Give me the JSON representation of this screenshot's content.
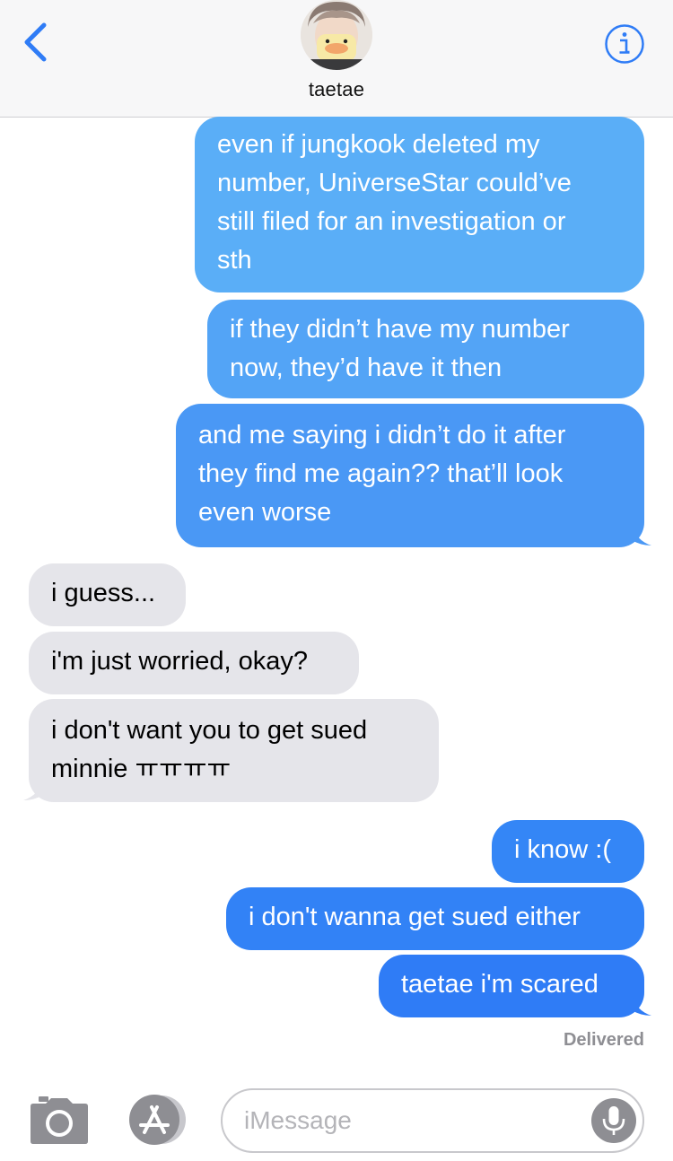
{
  "header": {
    "contact_name": "taetae",
    "back_icon": "chevron-left-icon",
    "info_icon": "info-icon",
    "accent_color": "#2f7cf6"
  },
  "messages": [
    {
      "direction": "outgoing",
      "text": "even if jungkook deleted my\nnumber, UniverseStar could’ve\nstill filed for an investigation or\nsth"
    },
    {
      "direction": "outgoing",
      "text": "if they didn’t have my number\nnow, they’d have it then"
    },
    {
      "direction": "outgoing",
      "text": "and me saying i didn’t do it after\nthey find me again?? that’ll look\neven worse"
    },
    {
      "direction": "incoming",
      "text": "i guess..."
    },
    {
      "direction": "incoming",
      "text": "i'm just worried, okay?"
    },
    {
      "direction": "incoming",
      "text": "i don't want you to get sued\nminnie ㅠㅠㅠㅠ"
    },
    {
      "direction": "outgoing",
      "text": "i know :("
    },
    {
      "direction": "outgoing",
      "text": "i don't wanna get sued either"
    },
    {
      "direction": "outgoing",
      "text": "taetae i'm scared"
    }
  ],
  "status": {
    "delivered": "Delivered"
  },
  "composer": {
    "placeholder": "iMessage",
    "camera_icon": "camera-icon",
    "apps_icon": "app-store-icon",
    "mic_icon": "microphone-icon"
  },
  "colors": {
    "outgoing_top": "#5ab0f7",
    "outgoing_bottom": "#2f7cf6",
    "incoming": "#e5e5ea"
  }
}
